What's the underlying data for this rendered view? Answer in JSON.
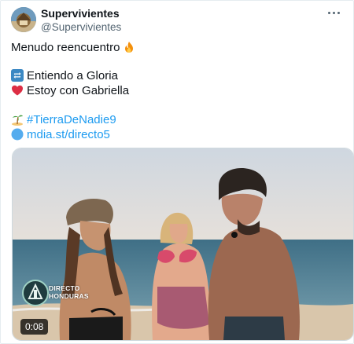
{
  "tweet": {
    "author_name": "Supervivientes",
    "author_handle": "@Supervivientes",
    "text_line1": "Menudo reencuentro",
    "line_retweet": "Entiendo a Gloria",
    "line_heart": "Estoy con Gabriella",
    "hashtag": "#TierraDeNadie9",
    "link": "mdia.st/directo5"
  },
  "video": {
    "duration": "0:08",
    "overlay_line1": "DIRECTO",
    "overlay_line2": "HONDURAS"
  },
  "icons": {
    "fire": "fire-emoji",
    "retweet": "repeat-emoji",
    "heart": "red-heart-emoji",
    "island": "desert-island-emoji",
    "globe": "blue-circle-emoji",
    "more": "more-options-icon"
  },
  "colors": {
    "link": "#1d9bf0",
    "text": "#0f1419",
    "muted": "#536471"
  }
}
